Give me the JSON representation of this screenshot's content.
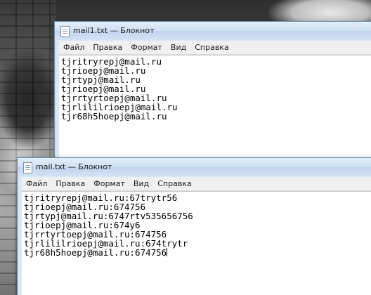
{
  "windows": {
    "back": {
      "title": "mail1.txt — Блокнот",
      "menu": [
        "Файл",
        "Правка",
        "Формат",
        "Вид",
        "Справка"
      ],
      "lines": [
        "tjritryrepj@mail.ru",
        "tjrioepj@mail.ru",
        "tjrtypj@mail.ru",
        "tjrioepj@mail.ru",
        "tjrrtyrtoepj@mail.ru",
        "tjrlililrioepj@mail.ru",
        "tjr68h5hoepj@mail.ru"
      ]
    },
    "front": {
      "title": "mail.txt — Блокнот",
      "menu": [
        "Файл",
        "Правка",
        "Формат",
        "Вид",
        "Справка"
      ],
      "lines": [
        "tjritryrepj@mail.ru:67trytr56",
        "tjrioepj@mail.ru:674756",
        "tjrtypj@mail.ru:6747rtv535656756",
        "tjrioepj@mail.ru:674y6",
        "tjrrtyrtoepj@mail.ru:674756",
        "tjrlililrioepj@mail.ru:674trytr",
        "tjr68h5hoepj@mail.ru:674756"
      ]
    }
  },
  "icons": {
    "window_icon": "notepad-icon"
  },
  "colors": {
    "titlebar": "#cfdff2",
    "menubar": "#f0f0f0",
    "editor": "#ffffff"
  }
}
